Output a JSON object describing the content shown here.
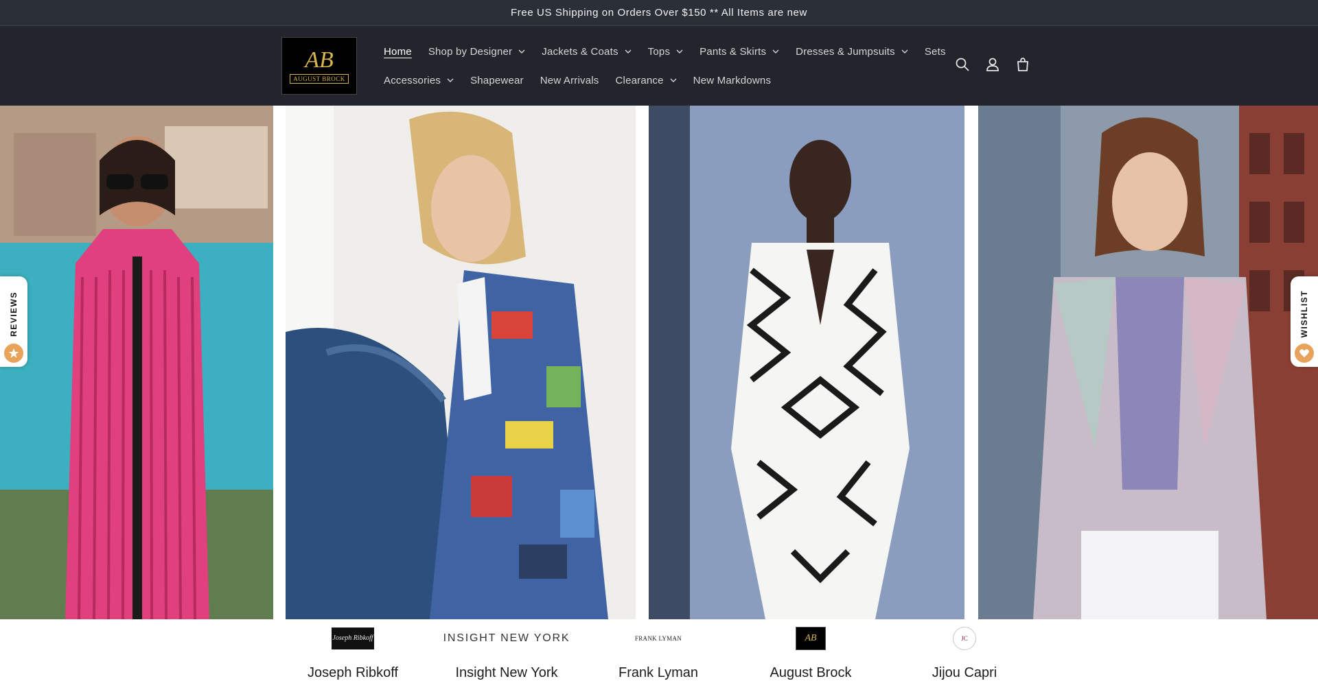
{
  "announcement": {
    "text": "Free US Shipping on Orders Over $150 ** All Items are new"
  },
  "logo": {
    "monogram": "AB",
    "text": "AUGUST BROCK",
    "accent_color": "#d7b450"
  },
  "nav": {
    "row1": [
      {
        "label": "Home",
        "active": true,
        "has_dropdown": false
      },
      {
        "label": "Shop by Designer",
        "has_dropdown": true
      },
      {
        "label": "Jackets & Coats",
        "has_dropdown": true
      },
      {
        "label": "Tops",
        "has_dropdown": true
      },
      {
        "label": "Pants & Skirts",
        "has_dropdown": true
      },
      {
        "label": "Dresses & Jumpsuits",
        "has_dropdown": true
      },
      {
        "label": "Sets",
        "has_dropdown": false
      }
    ],
    "row2": [
      {
        "label": "Accessories",
        "has_dropdown": true
      },
      {
        "label": "Shapewear",
        "has_dropdown": false
      },
      {
        "label": "New Arrivals",
        "has_dropdown": false
      },
      {
        "label": "Clearance",
        "has_dropdown": true
      },
      {
        "label": "New Markdowns",
        "has_dropdown": false
      }
    ]
  },
  "header_icons": [
    "search-icon",
    "account-icon",
    "cart-icon"
  ],
  "side_tabs": {
    "reviews": "REVIEWS",
    "wishlist": "WISHLIST",
    "badge_color": "#e8a35a"
  },
  "brands": [
    {
      "name": "Joseph Ribkoff",
      "logo_text": "Joseph Ribkoff"
    },
    {
      "name": "Insight New York",
      "logo_text": "INSIGHT NEW YORK"
    },
    {
      "name": "Frank Lyman",
      "logo_text": "FRANK LYMAN"
    },
    {
      "name": "August Brock",
      "logo_text": "AB"
    },
    {
      "name": "Jijou Capri",
      "logo_text": "JC"
    }
  ],
  "colors": {
    "announcement_bg": "#2b2f38",
    "header_bg": "#22252c",
    "nav_text": "#d6d6d6"
  }
}
